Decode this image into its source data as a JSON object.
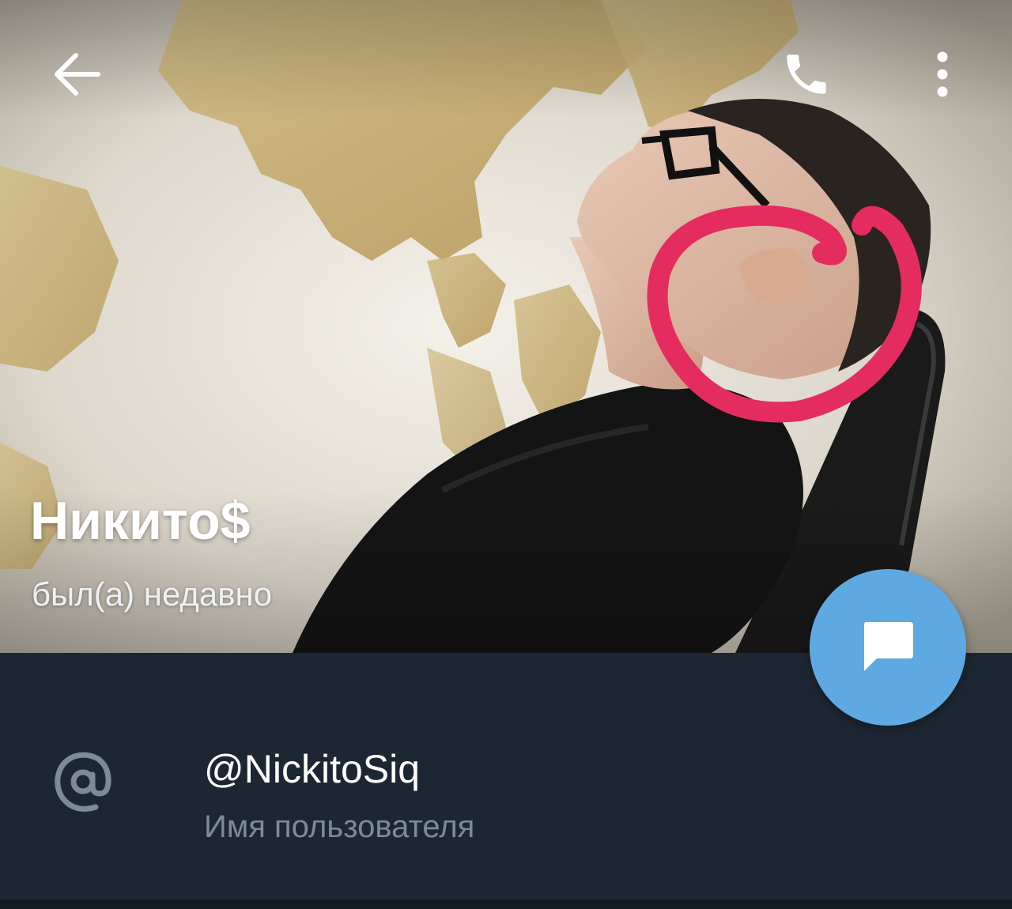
{
  "header": {
    "name": "Никито$",
    "status": "был(а) недавно"
  },
  "toolbar": {
    "back_icon": "arrow-left-icon",
    "call_icon": "phone-icon",
    "menu_icon": "more-vertical-icon"
  },
  "fab": {
    "icon": "chat-bubble-icon",
    "color": "#5fa9e3"
  },
  "info": {
    "username": "@NickitoSiq",
    "username_caption": "Имя пользователя",
    "icon": "at-sign-icon"
  },
  "colors": {
    "background": "#1d2733",
    "secondary_text": "#7d8b99",
    "annotation_circle": "#e42d5e"
  }
}
